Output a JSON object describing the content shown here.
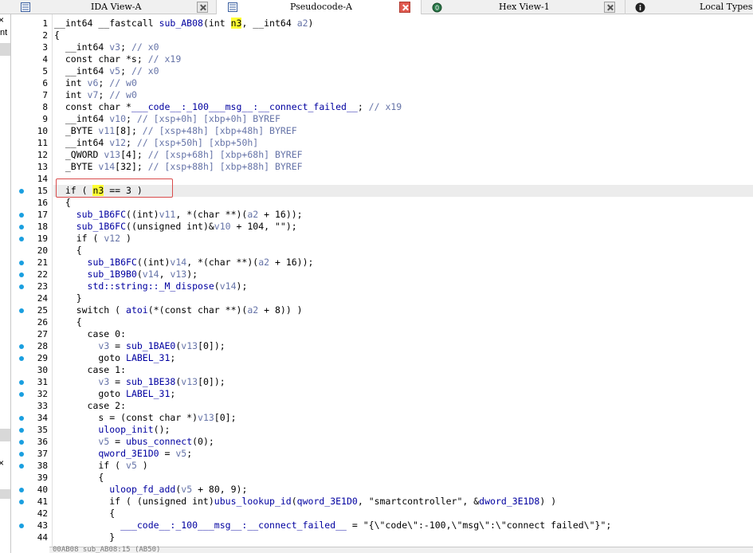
{
  "tabs": [
    {
      "label": "IDA View-A",
      "icon": "text-view-icon",
      "active": false,
      "close_style": "gray"
    },
    {
      "label": "Pseudocode-A",
      "icon": "text-view-icon",
      "active": true,
      "close_style": "red"
    },
    {
      "label": "Hex View-1",
      "icon": "hex-icon",
      "active": false,
      "close_style": "gray"
    },
    {
      "label": "Local Types",
      "icon": "info-icon",
      "active": false,
      "close_style": "none"
    }
  ],
  "left_panel": {
    "text": "nt",
    "close_glyph": "×"
  },
  "highlight_color": "#ffff33",
  "breakpoint_color": "#1a9fe0",
  "selection_box_color": "#d94b4b",
  "current_line": 15,
  "status_text": "00AB08  sub_AB08:15 (AB50)",
  "lines": [
    {
      "n": "1",
      "dot": false,
      "text": "__int64 __fastcall sub_AB08(int n3, __int64 a2)"
    },
    {
      "n": "2",
      "dot": false,
      "text": "{"
    },
    {
      "n": "3",
      "dot": false,
      "text": "  __int64 v3; // x0"
    },
    {
      "n": "4",
      "dot": false,
      "text": "  const char *s; // x19"
    },
    {
      "n": "5",
      "dot": false,
      "text": "  __int64 v5; // x0"
    },
    {
      "n": "6",
      "dot": false,
      "text": "  int v6; // w0"
    },
    {
      "n": "7",
      "dot": false,
      "text": "  int v7; // w0"
    },
    {
      "n": "8",
      "dot": false,
      "text": "  const char *___code__:_100___msg__:__connect_failed__; // x19"
    },
    {
      "n": "9",
      "dot": false,
      "text": "  __int64 v10; // [xsp+0h] [xbp+0h] BYREF"
    },
    {
      "n": "10",
      "dot": false,
      "text": "  _BYTE v11[8]; // [xsp+48h] [xbp+48h] BYREF"
    },
    {
      "n": "11",
      "dot": false,
      "text": "  __int64 v12; // [xsp+50h] [xbp+50h]"
    },
    {
      "n": "12",
      "dot": false,
      "text": "  _QWORD v13[4]; // [xsp+68h] [xbp+68h] BYREF"
    },
    {
      "n": "13",
      "dot": false,
      "text": "  _BYTE v14[32]; // [xsp+88h] [xbp+88h] BYREF"
    },
    {
      "n": "14",
      "dot": false,
      "text": ""
    },
    {
      "n": "15",
      "dot": true,
      "text": "  if ( n3 == 3 )"
    },
    {
      "n": "16",
      "dot": false,
      "text": "  {"
    },
    {
      "n": "17",
      "dot": true,
      "text": "    sub_1B6FC((int)v11, *(char **)(a2 + 16));"
    },
    {
      "n": "18",
      "dot": true,
      "text": "    sub_1B6FC((unsigned int)&v10 + 104, \"\");"
    },
    {
      "n": "19",
      "dot": true,
      "text": "    if ( v12 )"
    },
    {
      "n": "20",
      "dot": false,
      "text": "    {"
    },
    {
      "n": "21",
      "dot": true,
      "text": "      sub_1B6FC((int)v14, *(char **)(a2 + 16));"
    },
    {
      "n": "22",
      "dot": true,
      "text": "      sub_1B9B0(v14, v13);"
    },
    {
      "n": "23",
      "dot": true,
      "text": "      std::string::_M_dispose(v14);"
    },
    {
      "n": "24",
      "dot": false,
      "text": "    }"
    },
    {
      "n": "25",
      "dot": true,
      "text": "    switch ( atoi(*(const char **)(a2 + 8)) )"
    },
    {
      "n": "26",
      "dot": false,
      "text": "    {"
    },
    {
      "n": "27",
      "dot": false,
      "text": "      case 0:"
    },
    {
      "n": "28",
      "dot": true,
      "text": "        v3 = sub_1BAE0(v13[0]);"
    },
    {
      "n": "29",
      "dot": true,
      "text": "        goto LABEL_31;"
    },
    {
      "n": "30",
      "dot": false,
      "text": "      case 1:"
    },
    {
      "n": "31",
      "dot": true,
      "text": "        v3 = sub_1BE38(v13[0]);"
    },
    {
      "n": "32",
      "dot": true,
      "text": "        goto LABEL_31;"
    },
    {
      "n": "33",
      "dot": false,
      "text": "      case 2:"
    },
    {
      "n": "34",
      "dot": true,
      "text": "        s = (const char *)v13[0];"
    },
    {
      "n": "35",
      "dot": true,
      "text": "        uloop_init();"
    },
    {
      "n": "36",
      "dot": true,
      "text": "        v5 = ubus_connect(0);"
    },
    {
      "n": "37",
      "dot": true,
      "text": "        qword_3E1D0 = v5;"
    },
    {
      "n": "38",
      "dot": true,
      "text": "        if ( v5 )"
    },
    {
      "n": "39",
      "dot": false,
      "text": "        {"
    },
    {
      "n": "40",
      "dot": true,
      "text": "          uloop_fd_add(v5 + 80, 9);"
    },
    {
      "n": "41",
      "dot": true,
      "text": "          if ( (unsigned int)ubus_lookup_id(qword_3E1D0, \"smartcontroller\", &dword_3E1D8) )"
    },
    {
      "n": "42",
      "dot": false,
      "text": "          {"
    },
    {
      "n": "43",
      "dot": true,
      "text": "            ___code__:_100___msg__:__connect_failed__ = \"{\\\"code\\\":-100,\\\"msg\\\":\\\"connect failed\\\"}\";"
    },
    {
      "n": "44",
      "dot": false,
      "text": "          }"
    }
  ]
}
